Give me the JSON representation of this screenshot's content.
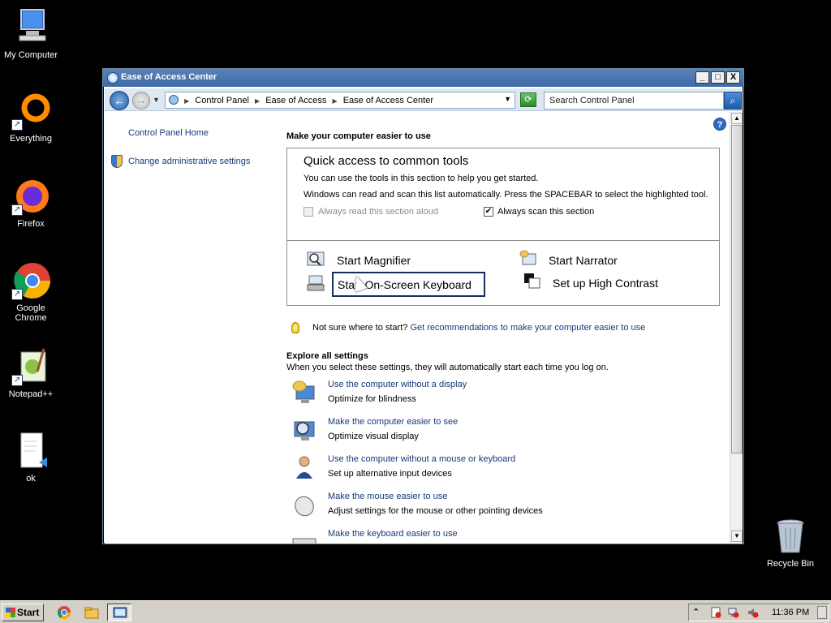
{
  "desktop": {
    "icons": [
      {
        "label": "My Computer"
      },
      {
        "label": "Everything"
      },
      {
        "label": "Firefox"
      },
      {
        "label": "Google Chrome"
      },
      {
        "label": "Notepad++"
      },
      {
        "label": "ok"
      },
      {
        "label": "Recycle Bin"
      }
    ]
  },
  "window": {
    "title": "Ease of Access Center",
    "buttons": {
      "minimize": "_",
      "maximize": "□",
      "close": "X"
    },
    "breadcrumbs": [
      "Control Panel",
      "Ease of Access",
      "Ease of Access Center"
    ],
    "search_placeholder": "Search Control Panel"
  },
  "left_pane": {
    "home_link": "Control Panel Home",
    "admin_link": "Change administrative settings"
  },
  "content": {
    "heading": "Make your computer easier to use",
    "quick": {
      "title": "Quick access to common tools",
      "line1": "You can use the tools in this section to help you get started.",
      "line2": "Windows can read and scan this list automatically.  Press the SPACEBAR to select the highlighted tool.",
      "read_aloud": {
        "label": "Always read this section aloud",
        "checked": false,
        "enabled": false
      },
      "scan": {
        "label": "Always scan this section",
        "checked": true
      },
      "tools": {
        "magnifier": "Start Magnifier",
        "narrator": "Start Narrator",
        "keyboard": "Start On-Screen Keyboard",
        "contrast": "Set up High Contrast"
      }
    },
    "tip": {
      "prefix": "Not sure where to start?",
      "link": "Get recommendations to make your computer easier to use"
    },
    "explore": {
      "heading": "Explore all settings",
      "description": "When you select these settings, they will automatically start each time you log on.",
      "items": [
        {
          "link": "Use the computer without a display",
          "desc": "Optimize for blindness"
        },
        {
          "link": "Make the computer easier to see",
          "desc": "Optimize visual display"
        },
        {
          "link": "Use the computer without a mouse or keyboard",
          "desc": "Set up alternative input devices"
        },
        {
          "link": "Make the mouse easier to use",
          "desc": "Adjust settings for the mouse or other pointing devices"
        },
        {
          "link": "Make the keyboard easier to use",
          "desc": ""
        }
      ]
    }
  },
  "taskbar": {
    "start_label": "Start",
    "clock": "11:36 PM"
  }
}
